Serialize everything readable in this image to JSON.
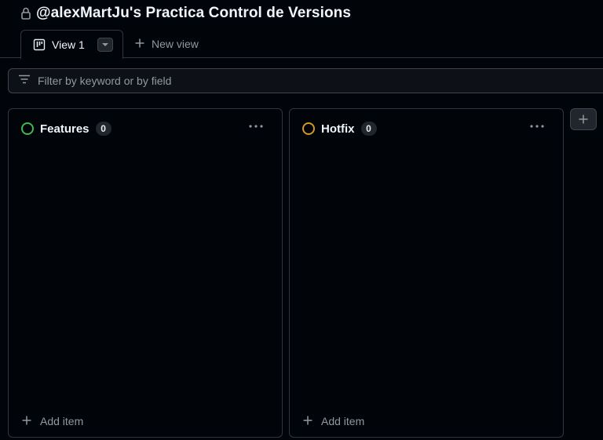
{
  "project": {
    "title": "@alexMartJu's Practica Control de Versions",
    "lock_icon": "lock-icon"
  },
  "views": {
    "active_tab": "View 1",
    "new_view_label": "New view"
  },
  "filter": {
    "placeholder": "Filter by keyword or by field"
  },
  "columns": [
    {
      "name": "Features",
      "count": "0",
      "status_color": "#3fb950",
      "add_label": "Add item"
    },
    {
      "name": "Hotfix",
      "count": "0",
      "status_color": "#d29922",
      "add_label": "Add item"
    }
  ],
  "colors": {
    "background": "#010409",
    "border": "#30363d",
    "muted_text": "#9198a1"
  }
}
